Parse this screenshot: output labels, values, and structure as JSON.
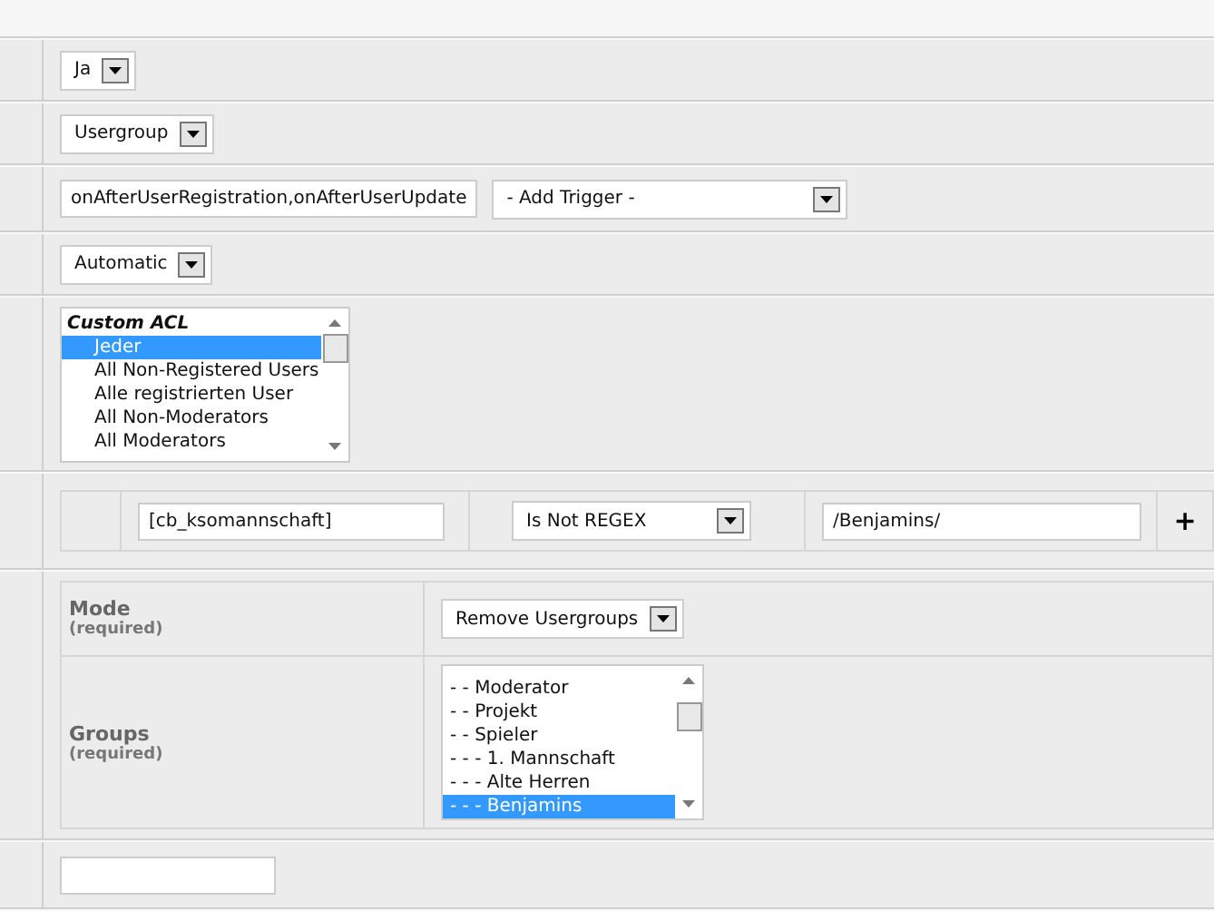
{
  "rows": [
    {
      "kind": "select",
      "value": "Ja"
    },
    {
      "kind": "select",
      "value": "Usergroup"
    },
    {
      "kind": "trigger",
      "value": "onAfterUserRegistration,onAfterUserUpdate",
      "select": "- Add Trigger -"
    },
    {
      "kind": "select",
      "value": "Automatic"
    },
    {
      "kind": "list",
      "items": [
        {
          "kind": "group",
          "label": "Custom ACL",
          "selected": false
        },
        {
          "kind": "option",
          "label": "Jeder",
          "selected": true
        },
        {
          "kind": "option",
          "label": "All Non-Registered Users",
          "selected": false
        },
        {
          "kind": "option",
          "label": "Alle registrierten User",
          "selected": false
        },
        {
          "kind": "option",
          "label": "All Non-Moderators",
          "selected": false
        },
        {
          "kind": "option",
          "label": "All Moderators",
          "selected": false
        }
      ]
    },
    {
      "kind": "condition",
      "field": "[cb_ksomannschaft]",
      "operator": "Is Not REGEX",
      "value": "/Benjamins/",
      "add": "+"
    },
    {
      "kind": "params",
      "params": [
        {
          "kind": "select",
          "label": "Mode",
          "hint": "(required)",
          "value": "Remove Usergroups"
        },
        {
          "kind": "list",
          "label": "Groups",
          "hint": "(required)",
          "items": [
            {
              "label": "- - Moderator",
              "selected": false
            },
            {
              "label": "- - Projekt",
              "selected": false
            },
            {
              "label": "- - Spieler",
              "selected": false
            },
            {
              "label": "- - - 1. Mannschaft",
              "selected": false
            },
            {
              "label": "- - - Alte Herren",
              "selected": false
            },
            {
              "label": "- - - Benjamins",
              "selected": true
            }
          ]
        }
      ]
    },
    {
      "kind": "input",
      "value": ""
    }
  ]
}
